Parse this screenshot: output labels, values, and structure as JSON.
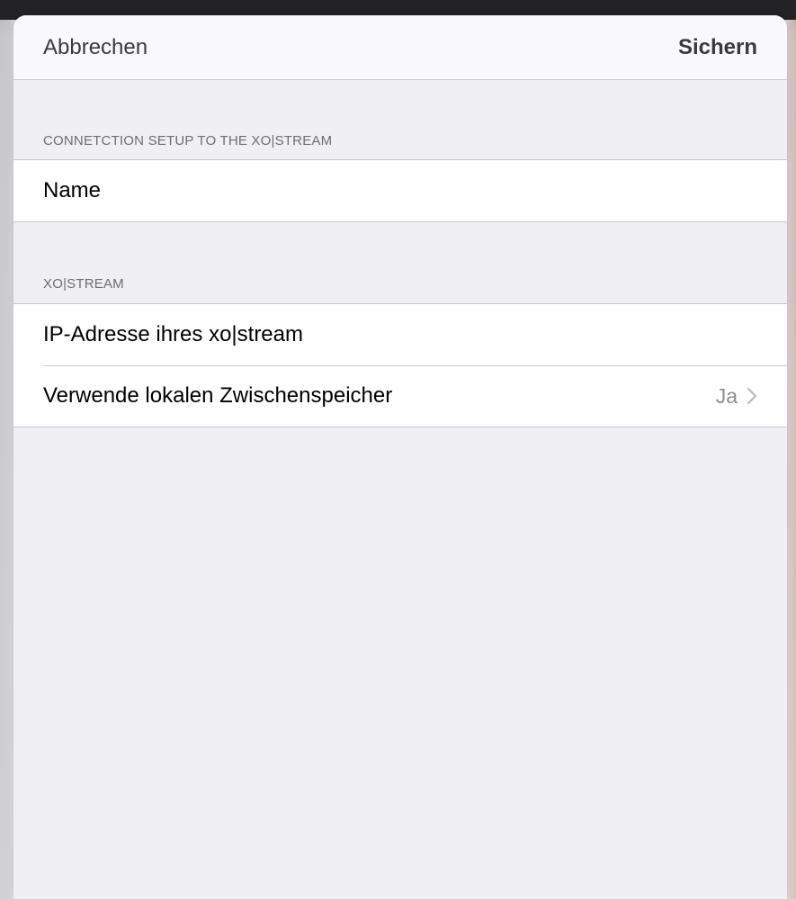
{
  "navbar": {
    "cancel_label": "Abbrechen",
    "save_label": "Sichern"
  },
  "sections": [
    {
      "header": "CONNETCTION SETUP TO THE XO|STREAM",
      "rows": [
        {
          "placeholder": "Name"
        }
      ]
    },
    {
      "header": "XO|STREAM",
      "rows": [
        {
          "placeholder": "IP-Adresse ihres xo|stream"
        },
        {
          "label": "Verwende lokalen Zwischenspeicher",
          "value": "Ja",
          "icon": "chevron-right-icon"
        }
      ]
    }
  ],
  "colors": {
    "sheet_background": "#efeff4",
    "cell_background": "#ffffff",
    "separator": "#c8c7cc",
    "section_header_text": "#6d6d72",
    "secondary_value": "#8e8e93"
  }
}
